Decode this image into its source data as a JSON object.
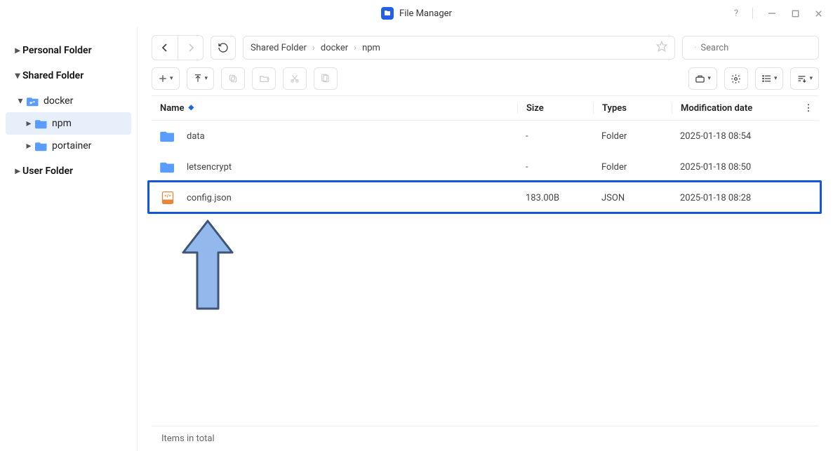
{
  "app": {
    "title": "File Manager"
  },
  "window_controls": {
    "help": "?",
    "minimize": "—",
    "maximize": "□",
    "close": "✕"
  },
  "sidebar": {
    "roots": [
      {
        "label": "Personal Folder",
        "expanded": false
      },
      {
        "label": "Shared Folder",
        "expanded": true,
        "children": [
          {
            "label": "docker",
            "expanded": true,
            "icon": "shared-folder",
            "children": [
              {
                "label": "npm",
                "selected": true
              },
              {
                "label": "portainer",
                "selected": false
              }
            ]
          }
        ]
      },
      {
        "label": "User Folder",
        "expanded": false
      }
    ]
  },
  "breadcrumb": {
    "segments": [
      "Shared Folder",
      "docker",
      "npm"
    ]
  },
  "search": {
    "placeholder": "Search"
  },
  "columns": {
    "name": "Name",
    "size": "Size",
    "types": "Types",
    "date": "Modification date"
  },
  "files": [
    {
      "name": "data",
      "size": "-",
      "type": "Folder",
      "date": "2025-01-18 08:54",
      "kind": "folder"
    },
    {
      "name": "letsencrypt",
      "size": "-",
      "type": "Folder",
      "date": "2025-01-18 08:50",
      "kind": "folder"
    },
    {
      "name": "config.json",
      "size": "183.00B",
      "type": "JSON",
      "date": "2025-01-18 08:28",
      "kind": "json"
    }
  ],
  "status": {
    "text": "Items in total"
  },
  "highlight": {
    "row_index": 2,
    "arrow_color_fill": "#92b8ec",
    "arrow_color_stroke": "#3f5576"
  }
}
